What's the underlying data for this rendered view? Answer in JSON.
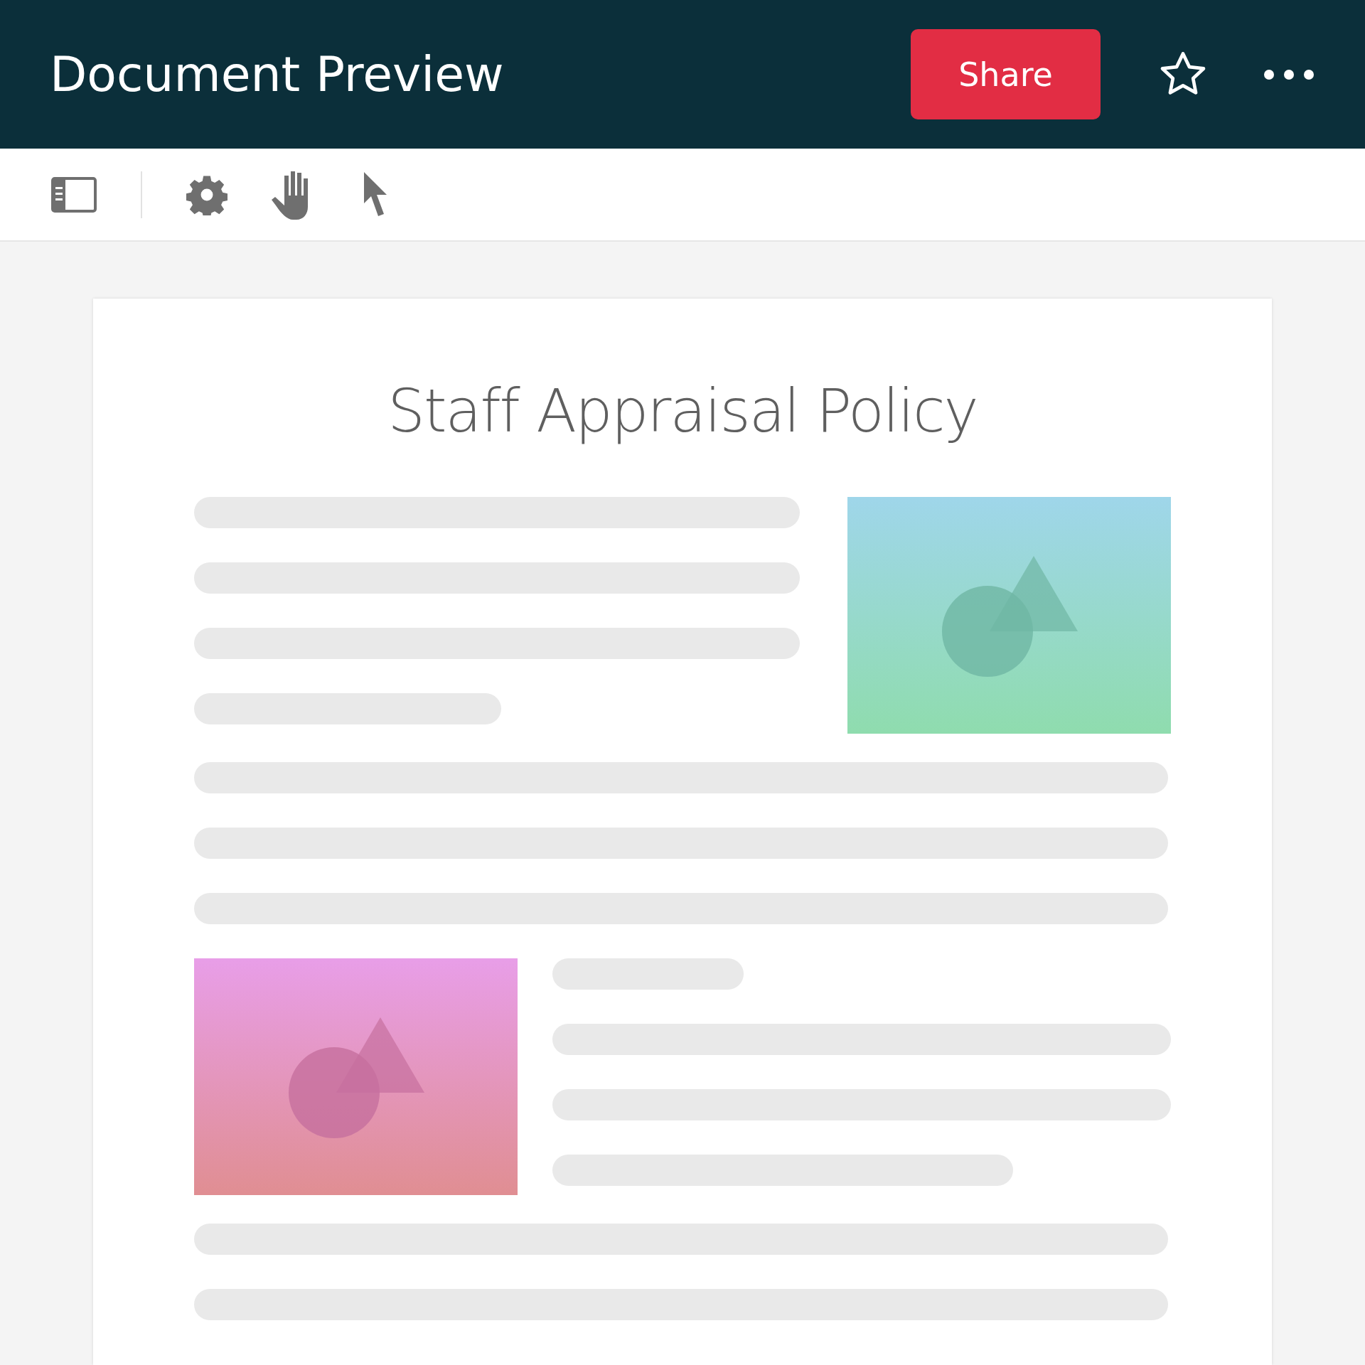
{
  "header": {
    "title": "Document Preview",
    "share_button": "Share"
  },
  "toolbar": [
    {
      "kind": "panel"
    },
    {
      "kind": "divider"
    },
    {
      "kind": "settings"
    },
    {
      "kind": "hand"
    },
    {
      "kind": "pointer"
    }
  ],
  "document": {
    "title": "Staff Appraisal Policy",
    "sections": [
      {
        "kind": "image-right",
        "color": "#9fd6ea"
      },
      {
        "kind": "lines"
      },
      {
        "kind": "image-left",
        "color": "#e89ee8"
      },
      {
        "kind": "lines-short"
      }
    ]
  }
}
